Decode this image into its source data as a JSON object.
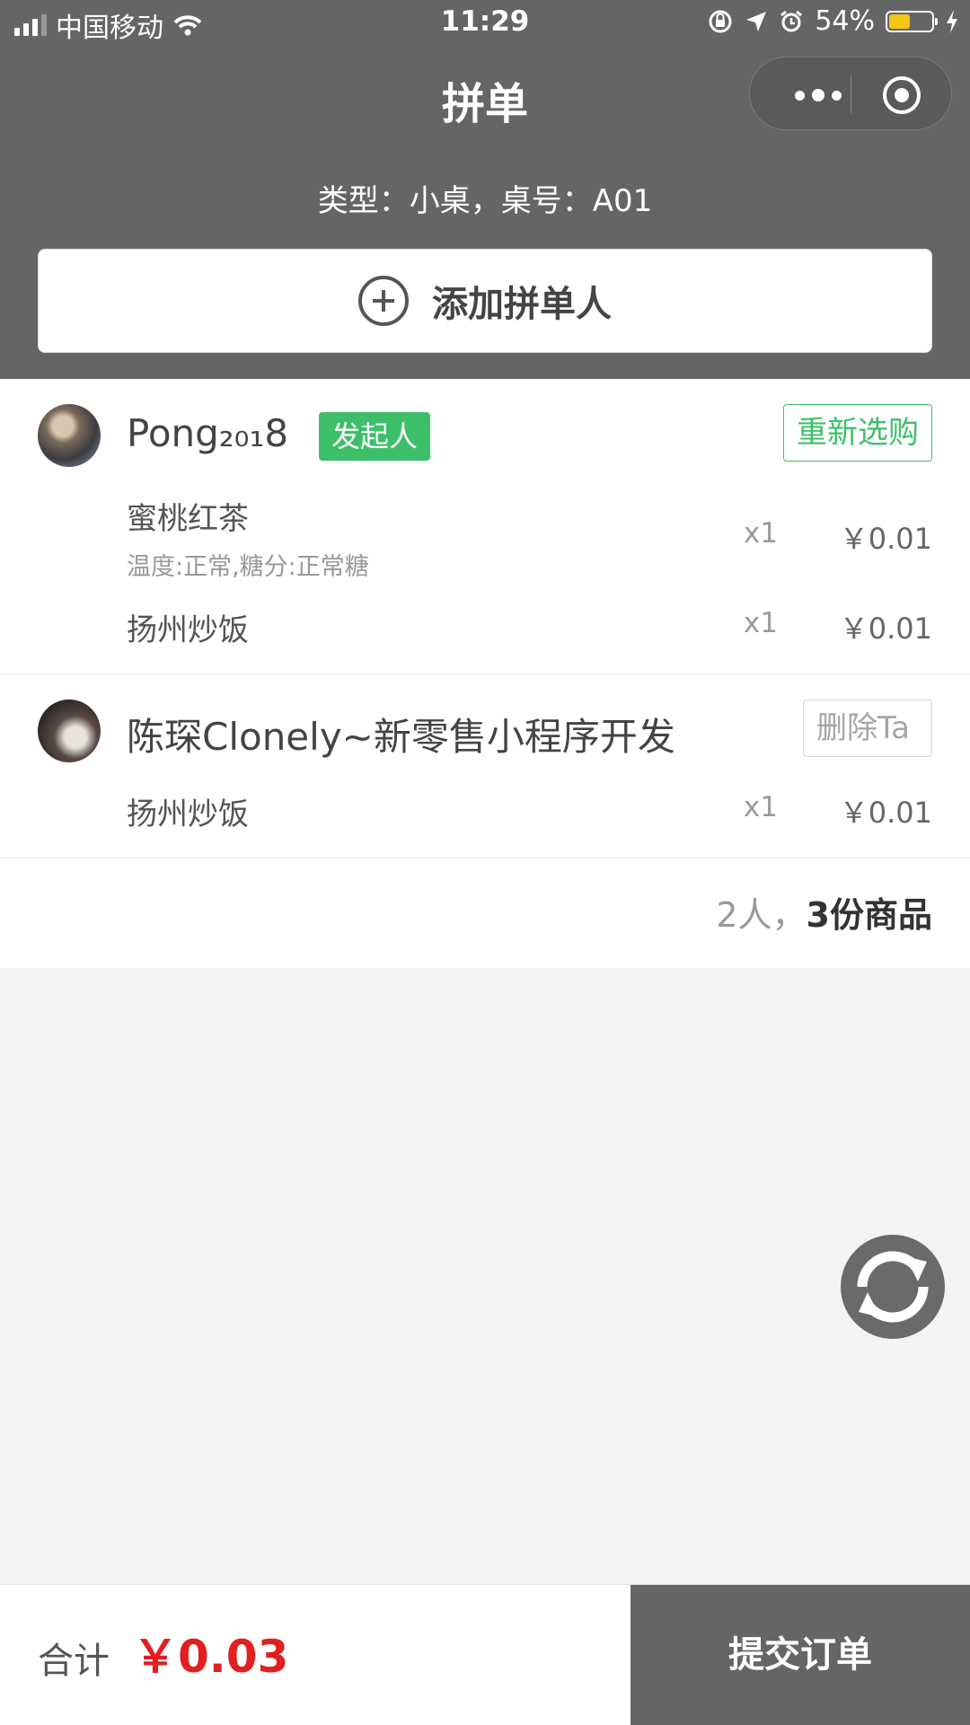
{
  "status_bar": {
    "carrier": "中国移动",
    "time": "11:29",
    "battery": "54%",
    "battery_level": 0.54
  },
  "nav": {
    "title": "拼单"
  },
  "table_info": "类型：小桌，桌号：A01",
  "add_button": "添加拼单人",
  "people": [
    {
      "name": "Pong₂₀₁8",
      "badge": "发起人",
      "action": "重新选购",
      "items": [
        {
          "name": "蜜桃红茶",
          "options": "温度:正常,糖分:正常糖",
          "qty": "x1",
          "price": "￥0.01"
        },
        {
          "name": "扬州炒饭",
          "options": "",
          "qty": "x1",
          "price": "￥0.01"
        }
      ]
    },
    {
      "name": "陈琛Clonely~新零售小程序开发",
      "action": "删除Ta",
      "items": [
        {
          "name": "扬州炒饭",
          "options": "",
          "qty": "x1",
          "price": "￥0.01"
        }
      ]
    }
  ],
  "summary": {
    "people": "2人，",
    "goods": "3份商品"
  },
  "footer": {
    "total_label": "合计",
    "total_amount": "￥0.03",
    "submit": "提交订单"
  },
  "colors": {
    "header": "#656565",
    "accent_green": "#3dbf6a",
    "price_red": "#e02020"
  },
  "icons": [
    "signal-icon",
    "wifi-icon",
    "orientation-lock-icon",
    "location-icon",
    "alarm-icon",
    "battery-icon",
    "charging-icon",
    "more-icon",
    "target-icon",
    "plus-circle-icon",
    "refresh-icon"
  ]
}
